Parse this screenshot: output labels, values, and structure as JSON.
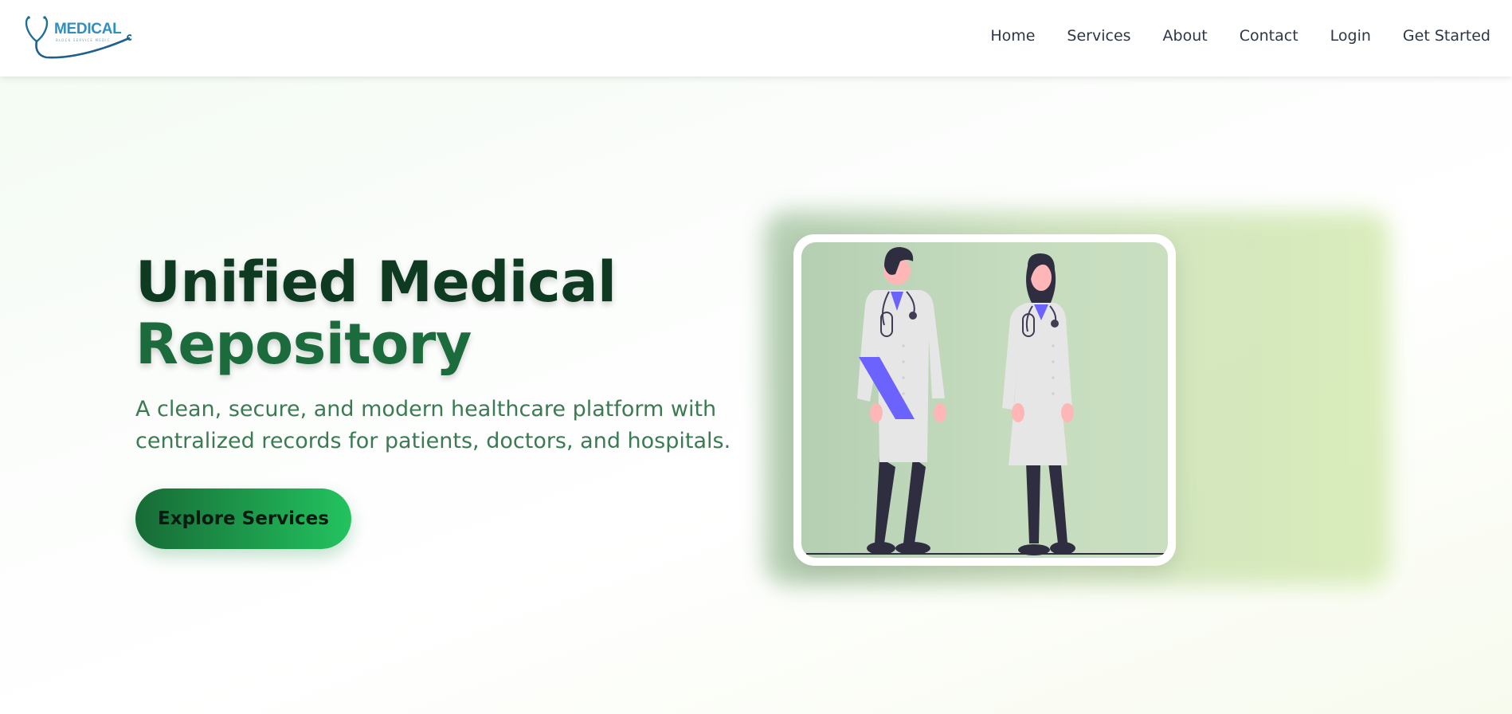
{
  "brand": {
    "name": "MEDICAL",
    "tagline": "BLOCK SERVICE MEDIC"
  },
  "nav": {
    "items": [
      "Home",
      "Services",
      "About",
      "Contact",
      "Login",
      "Get Started"
    ]
  },
  "hero": {
    "title_line1": "Unified Medical",
    "title_line2": "Repository",
    "subtitle": "A clean, secure, and modern healthcare platform with centralized records for patients, doctors, and hospitals.",
    "cta_label": "Explore Services"
  },
  "colors": {
    "brand_blue": "#2f8fbf",
    "title_dark": "#0f3a22",
    "title_green": "#1b6b3c",
    "subtitle_green": "#3b7a52",
    "cta_start": "#176b36",
    "cta_end": "#23c35f"
  },
  "icons": {
    "logo": "stethoscope-icon",
    "illustration": "doctors-illustration"
  }
}
